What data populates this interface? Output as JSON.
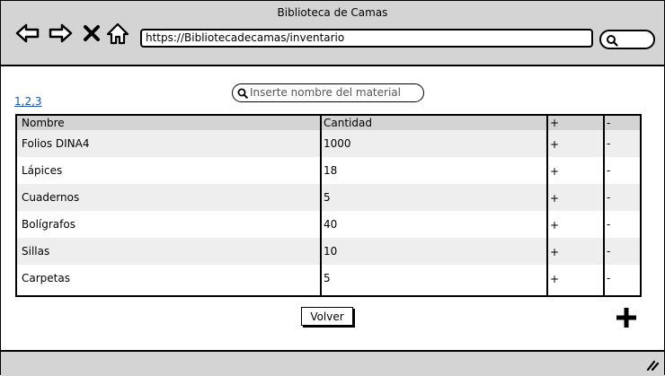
{
  "window": {
    "title": "Biblioteca de Camas"
  },
  "browser": {
    "url": "https://Bibliotecadecamas/inventario",
    "icons": [
      "back-arrow-icon",
      "forward-arrow-icon",
      "close-icon",
      "home-icon",
      "search-icon"
    ]
  },
  "pagination": {
    "label": "1,2,3"
  },
  "search": {
    "placeholder": "Inserte nombre del material"
  },
  "table": {
    "columns": [
      "Nombre",
      "Cantidad",
      "+",
      "-"
    ],
    "rows": [
      {
        "name": "Folios DINA4",
        "qty": "1000",
        "plus": "+",
        "minus": "-"
      },
      {
        "name": "Lápices",
        "qty": "18",
        "plus": "+",
        "minus": "-"
      },
      {
        "name": "Cuadernos",
        "qty": "5",
        "plus": "+",
        "minus": "-"
      },
      {
        "name": "Bolígrafos",
        "qty": "40",
        "plus": "+",
        "minus": "-"
      },
      {
        "name": "Sillas",
        "qty": "10",
        "plus": "+",
        "minus": "-"
      },
      {
        "name": "Carpetas",
        "qty": "5",
        "plus": "+",
        "minus": "-"
      }
    ]
  },
  "actions": {
    "back_label": "Volver",
    "add_icon": "plus-icon"
  },
  "colors": {
    "chrome": "#d4d4d4",
    "row_alt": "#eeeeee",
    "link": "#1a55a5"
  }
}
